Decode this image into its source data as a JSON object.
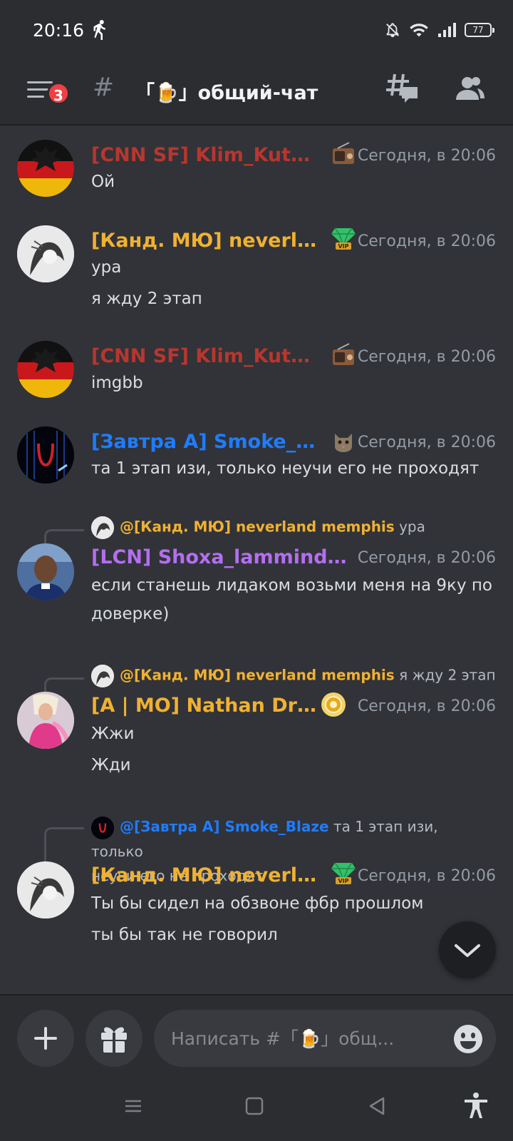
{
  "status_bar": {
    "time": "20:16",
    "battery": "77"
  },
  "header": {
    "notification_count": "3",
    "hash_symbol": "#",
    "channel_name": "「🍺」общий-чат"
  },
  "messages": [
    {
      "author": "[CNN SF] Klim_Kutuz...",
      "author_color": "#b8362e",
      "timestamp": "Сегодня, в 20:06",
      "role_icon": "radio-icon",
      "lines": [
        "Ой"
      ]
    },
    {
      "author": "[Канд. МЮ] neverlan...",
      "author_color": "#f0b132",
      "timestamp": "Сегодня, в 20:06",
      "role_icon": "vip-diamond-icon",
      "lines": [
        "ура",
        "я жду 2 этап"
      ]
    },
    {
      "author": "[CNN SF] Klim_Kutuz...",
      "author_color": "#b8362e",
      "timestamp": "Сегодня, в 20:06",
      "role_icon": "radio-icon",
      "lines": [
        "imgbb"
      ]
    },
    {
      "author": "[Завтра А] Smoke_Bl...",
      "author_color": "#1f7cff",
      "timestamp": "Сегодня, в 20:06",
      "role_icon": "cat-icon",
      "lines": [
        "та 1 этап изи, только неучи его не проходят"
      ]
    },
    {
      "reply_to": "@[Канд. МЮ] neverland memphis",
      "reply_to_color": "#f0b132",
      "reply_text": "ура",
      "author": "[LCN] Shoxa_lammindd [...",
      "author_color": "#b46ef0",
      "timestamp": "Сегодня, в 20:06",
      "lines": [
        "если станешь лидаком возьми меня на 9ку по",
        "доверке)"
      ]
    },
    {
      "reply_to": "@[Канд. МЮ] neverland memphis",
      "reply_to_color": "#f0b132",
      "reply_text": "я жду 2 этап",
      "author": "[A | MO] Nathan Dreyk",
      "author_color": "#f0b132",
      "timestamp": "Сегодня, в 20:06",
      "role_icon": "gold-coin-icon",
      "lines": [
        "Жжи",
        "Жди"
      ]
    },
    {
      "reply_to": "@[Завтра А] Smoke_Blaze",
      "reply_to_color": "#1f7cff",
      "reply_text": "та 1 этап изи, только",
      "reply_text_2": "неучи его не проходят",
      "author": "[Канд. МЮ] neverlan...",
      "author_color": "#f0b132",
      "timestamp": "Сегодня, в 20:06",
      "role_icon": "vip-diamond-icon",
      "lines": [
        "Ты бы сидел на обзвоне фбр прошлом",
        "ты бы так не говорил"
      ]
    }
  ],
  "composer": {
    "placeholder": "Написать #「🍺」общ..."
  }
}
